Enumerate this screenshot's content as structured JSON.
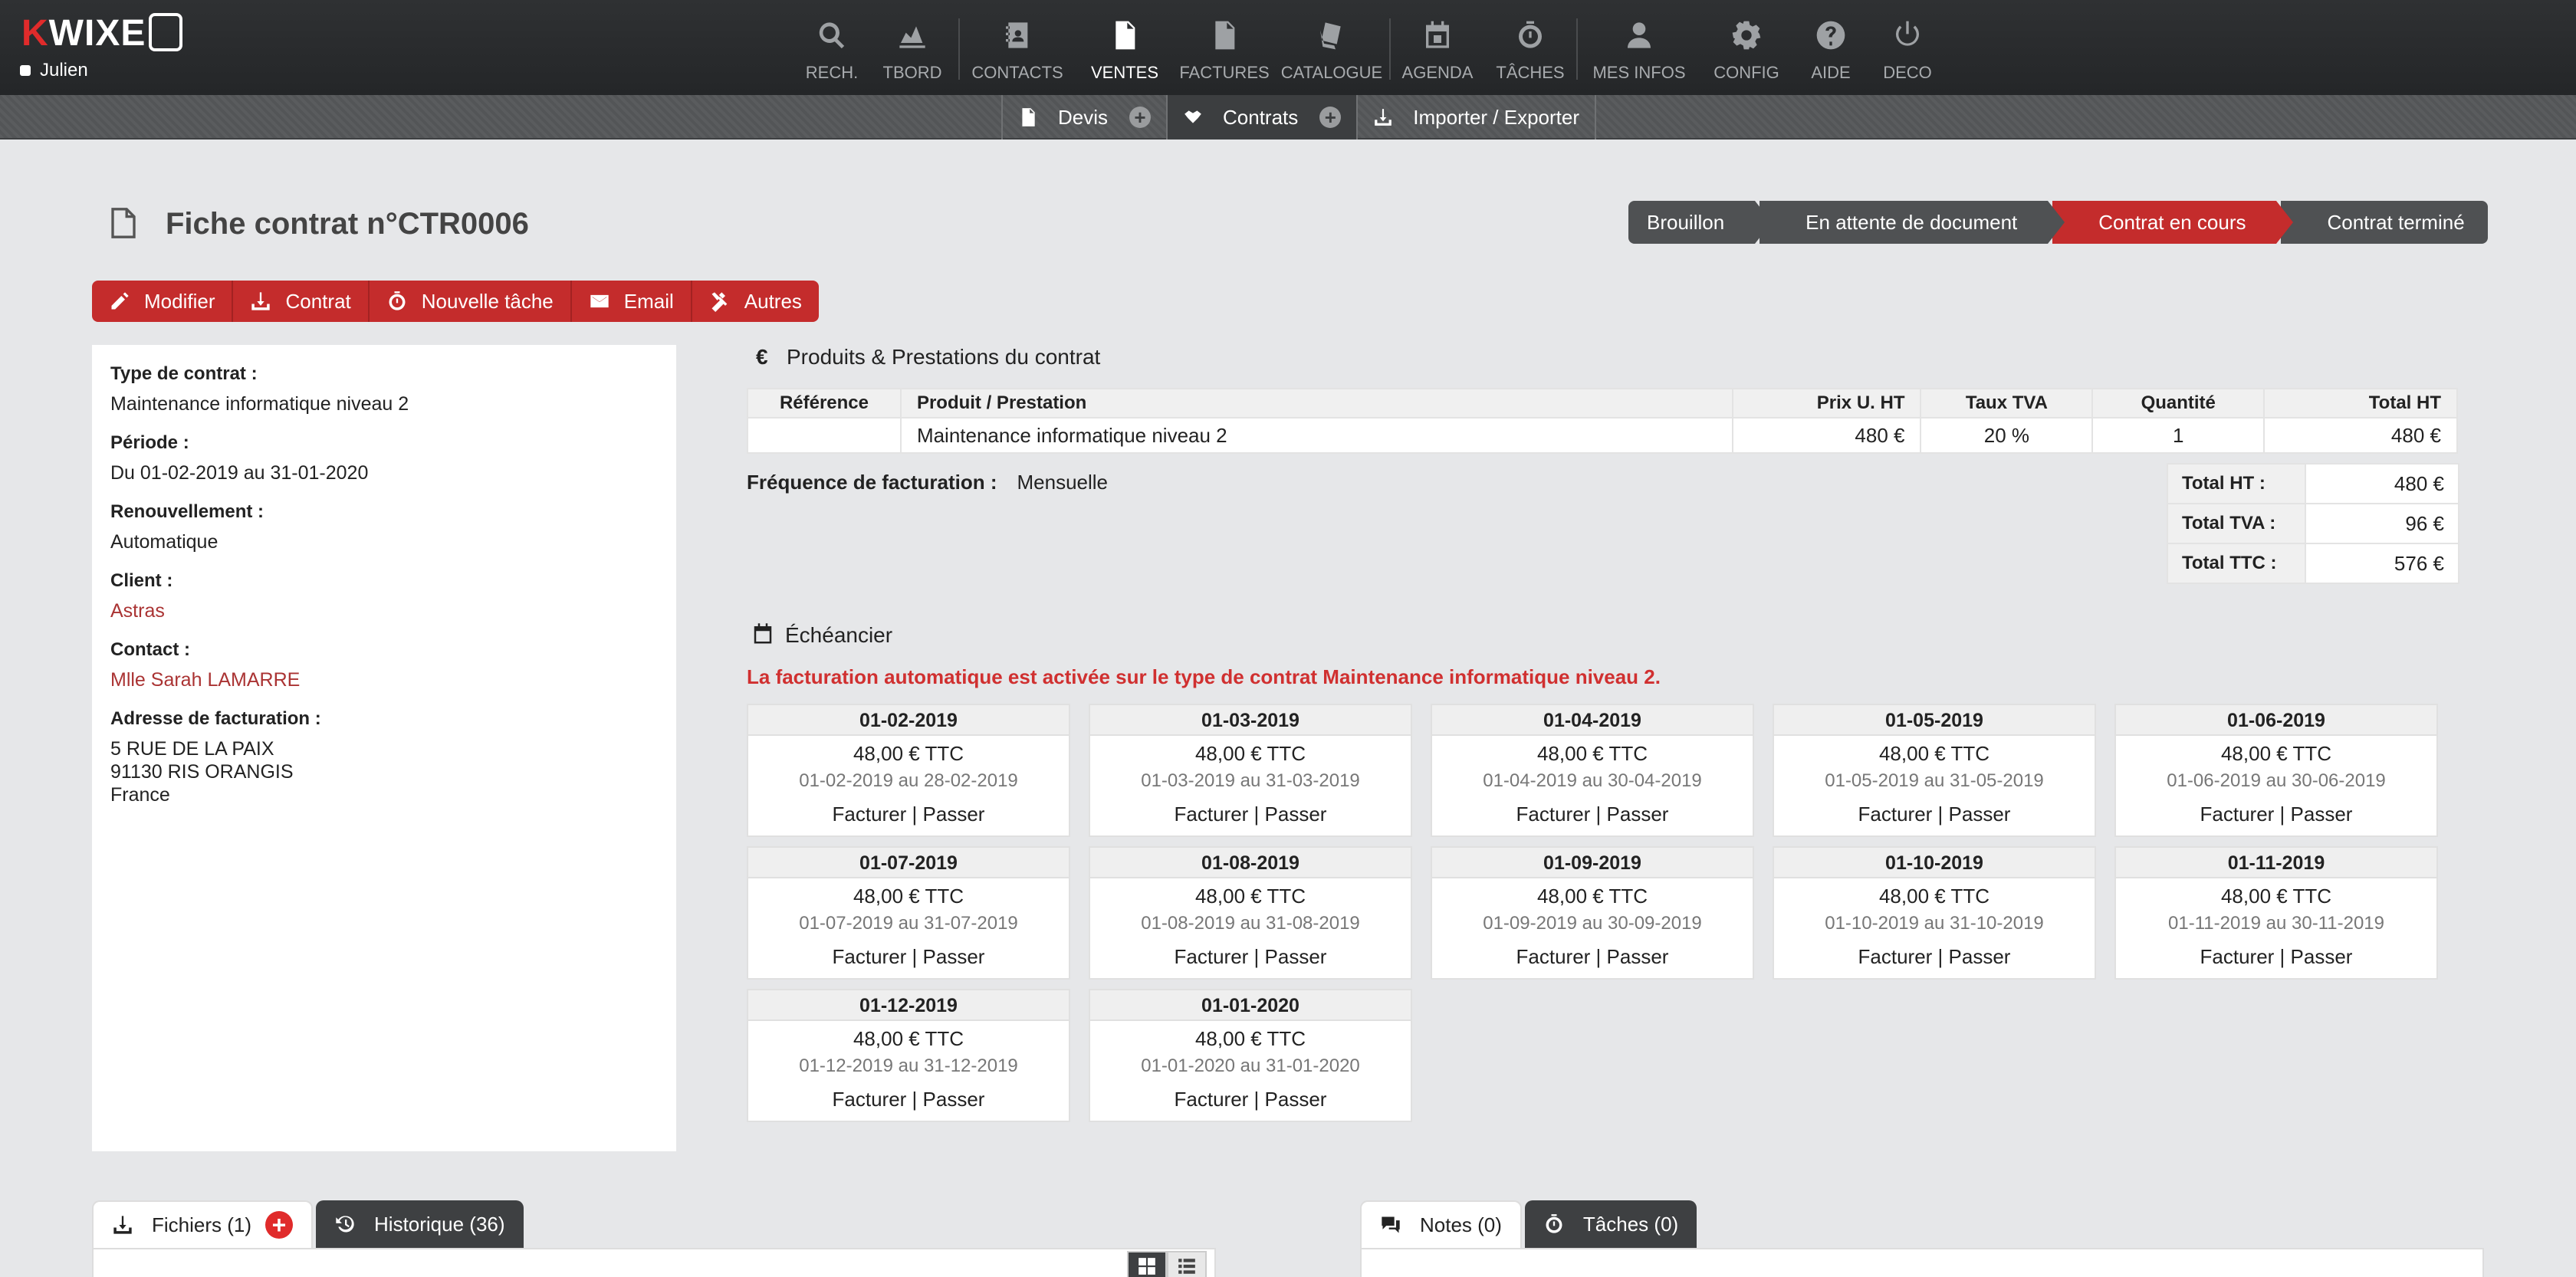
{
  "app": {
    "logo_k": "K",
    "logo_rest": "WIXE",
    "user": "Julien"
  },
  "nav": [
    {
      "label": "RECH.",
      "icon": "search-icon"
    },
    {
      "label": "TBORD",
      "icon": "chart-icon"
    },
    {
      "label": "CONTACTS",
      "icon": "address-book-icon"
    },
    {
      "label": "VENTES",
      "icon": "document-icon"
    },
    {
      "label": "FACTURES",
      "icon": "invoice-icon"
    },
    {
      "label": "CATALOGUE",
      "icon": "catalog-icon"
    },
    {
      "label": "AGENDA",
      "icon": "calendar-icon"
    },
    {
      "label": "TÂCHES",
      "icon": "stopwatch-icon"
    },
    {
      "label": "MES INFOS",
      "icon": "user-icon"
    },
    {
      "label": "CONFIG",
      "icon": "gear-icon"
    },
    {
      "label": "AIDE",
      "icon": "help-icon"
    },
    {
      "label": "DECO",
      "icon": "power-icon"
    }
  ],
  "subnav": {
    "devis": "Devis",
    "contrats": "Contrats",
    "import": "Importer / Exporter"
  },
  "page": {
    "title": "Fiche contrat n°CTR0006"
  },
  "steps": [
    "Brouillon",
    "En attente de document",
    "Contrat en cours",
    "Contrat terminé"
  ],
  "actions": {
    "modifier": "Modifier",
    "contrat": "Contrat",
    "tache": "Nouvelle tâche",
    "email": "Email",
    "autres": "Autres"
  },
  "info": {
    "type_label": "Type de contrat :",
    "type_value": "Maintenance informatique niveau 2",
    "periode_label": "Période :",
    "periode_value": "Du 01-02-2019 au 31-01-2020",
    "renouv_label": "Renouvellement :",
    "renouv_value": "Automatique",
    "client_label": "Client :",
    "client_value": "Astras",
    "contact_label": "Contact :",
    "contact_value": "Mlle Sarah LAMARRE",
    "adresse_label": "Adresse de facturation :",
    "adresse_l1": "5 RUE DE LA PAIX",
    "adresse_l2": "91130 RIS ORANGIS",
    "adresse_l3": "France"
  },
  "products": {
    "title": "Produits & Prestations du contrat",
    "currency_symbol": "€",
    "headers": {
      "ref": "Référence",
      "produit": "Produit / Prestation",
      "prix": "Prix U. HT",
      "tva": "Taux TVA",
      "qte": "Quantité",
      "total": "Total HT"
    },
    "row": {
      "ref": "",
      "produit": "Maintenance informatique niveau 2",
      "prix": "480 €",
      "tva": "20 %",
      "qte": "1",
      "total": "480 €"
    },
    "freq_label": "Fréquence de facturation :",
    "freq_value": "Mensuelle",
    "totals": {
      "ht_label": "Total HT :",
      "ht_value": "480 €",
      "tva_label": "Total TVA :",
      "tva_value": "96 €",
      "ttc_label": "Total TTC :",
      "ttc_value": "576 €"
    }
  },
  "echeancier": {
    "title": "Échéancier",
    "message": "La facturation automatique est activée sur le type de contrat Maintenance informatique niveau 2.",
    "cards": [
      {
        "date": "01-02-2019",
        "amount": "48,00 € TTC",
        "period": "01-02-2019 au 28-02-2019",
        "actions": "Facturer | Passer"
      },
      {
        "date": "01-03-2019",
        "amount": "48,00 € TTC",
        "period": "01-03-2019 au 31-03-2019",
        "actions": "Facturer | Passer"
      },
      {
        "date": "01-04-2019",
        "amount": "48,00 € TTC",
        "period": "01-04-2019 au 30-04-2019",
        "actions": "Facturer | Passer"
      },
      {
        "date": "01-05-2019",
        "amount": "48,00 € TTC",
        "period": "01-05-2019 au 31-05-2019",
        "actions": "Facturer | Passer"
      },
      {
        "date": "01-06-2019",
        "amount": "48,00 € TTC",
        "period": "01-06-2019 au 30-06-2019",
        "actions": "Facturer | Passer"
      },
      {
        "date": "01-07-2019",
        "amount": "48,00 € TTC",
        "period": "01-07-2019 au 31-07-2019",
        "actions": "Facturer | Passer"
      },
      {
        "date": "01-08-2019",
        "amount": "48,00 € TTC",
        "period": "01-08-2019 au 31-08-2019",
        "actions": "Facturer | Passer"
      },
      {
        "date": "01-09-2019",
        "amount": "48,00 € TTC",
        "period": "01-09-2019 au 30-09-2019",
        "actions": "Facturer | Passer"
      },
      {
        "date": "01-10-2019",
        "amount": "48,00 € TTC",
        "period": "01-10-2019 au 31-10-2019",
        "actions": "Facturer | Passer"
      },
      {
        "date": "01-11-2019",
        "amount": "48,00 € TTC",
        "period": "01-11-2019 au 30-11-2019",
        "actions": "Facturer | Passer"
      },
      {
        "date": "01-12-2019",
        "amount": "48,00 € TTC",
        "period": "01-12-2019 au 31-12-2019",
        "actions": "Facturer | Passer"
      },
      {
        "date": "01-01-2020",
        "amount": "48,00 € TTC",
        "period": "01-01-2020 au 31-01-2020",
        "actions": "Facturer | Passer"
      }
    ]
  },
  "bottom_tabs": {
    "fichiers": "Fichiers (1)",
    "historique": "Historique (36)",
    "notes": "Notes (0)",
    "taches": "Tâches (0)"
  },
  "colors": {
    "accent": "#c42c2c",
    "dark": "#2b2d2f",
    "link": "#a33333"
  }
}
